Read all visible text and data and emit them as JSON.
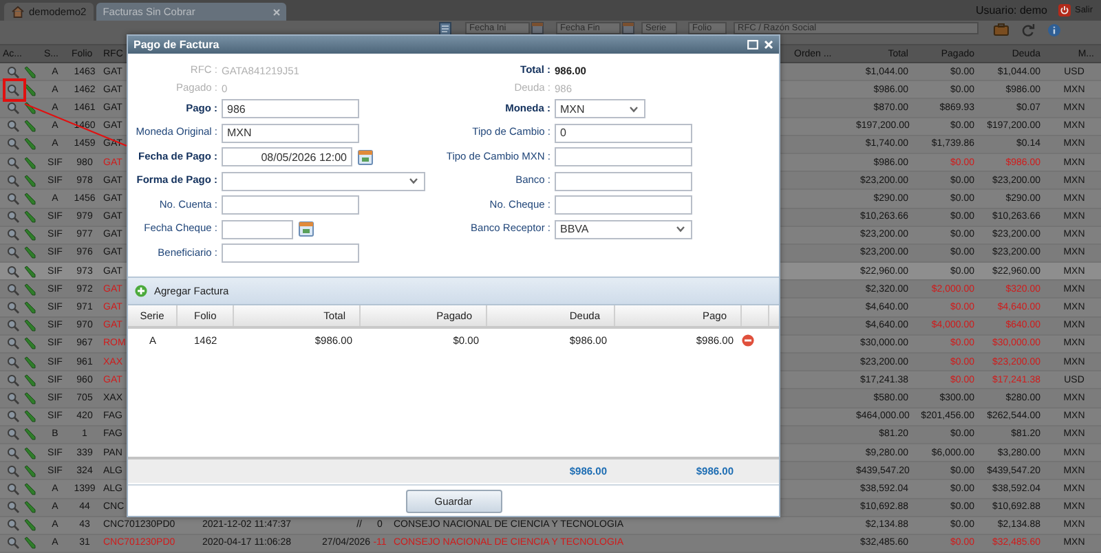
{
  "topbar": {
    "tabs": [
      {
        "label": "demodemo2",
        "kind": "home",
        "selected": false
      },
      {
        "label": "Facturas Sin Cobrar",
        "kind": "closable",
        "selected": true
      }
    ],
    "user": "Usuario: demo",
    "logout": "Salir"
  },
  "filters": [
    {
      "kind": "date",
      "placeholder": "Fecha Ini"
    },
    {
      "kind": "date",
      "placeholder": "Fecha Fin"
    },
    {
      "kind": "select",
      "placeholder": "Serie"
    },
    {
      "kind": "input",
      "placeholder": "Folio"
    },
    {
      "kind": "search",
      "placeholder": "RFC / Razón Social"
    }
  ],
  "table": {
    "columns": [
      "Ac...",
      "S...",
      "Folio",
      "RFC",
      "Orden ...",
      "Total",
      "Pagado",
      "Deuda",
      "M..."
    ],
    "rows": [
      {
        "s": "A",
        "folio": "1463",
        "rfc": "GAT",
        "total": "$1,044.00",
        "pagado": "$0.00",
        "deuda": "$1,044.00",
        "moneda": "USD",
        "overdue": false,
        "selected": false,
        "marked": false
      },
      {
        "s": "A",
        "folio": "1462",
        "rfc": "GAT",
        "total": "$986.00",
        "pagado": "$0.00",
        "deuda": "$986.00",
        "moneda": "MXN",
        "overdue": false,
        "selected": false,
        "marked": true
      },
      {
        "s": "A",
        "folio": "1461",
        "rfc": "GAT",
        "total": "$870.00",
        "pagado": "$869.93",
        "deuda": "$0.07",
        "moneda": "MXN",
        "overdue": false,
        "selected": false,
        "marked": false
      },
      {
        "s": "A",
        "folio": "1460",
        "rfc": "GAT",
        "total": "$197,200.00",
        "pagado": "$0.00",
        "deuda": "$197,200.00",
        "moneda": "MXN",
        "overdue": false,
        "selected": false,
        "marked": false
      },
      {
        "s": "A",
        "folio": "1459",
        "rfc": "GAT",
        "total": "$1,740.00",
        "pagado": "$1,739.86",
        "deuda": "$0.14",
        "moneda": "MXN",
        "overdue": false,
        "selected": false,
        "marked": false
      },
      {
        "s": "SIF",
        "folio": "980",
        "rfc": "GAT",
        "total": "$986.00",
        "pagado": "$0.00",
        "deuda": "$986.00",
        "moneda": "MXN",
        "overdue": true,
        "selected": false,
        "marked": false
      },
      {
        "s": "SIF",
        "folio": "978",
        "rfc": "GAT",
        "total": "$23,200.00",
        "pagado": "$0.00",
        "deuda": "$23,200.00",
        "moneda": "MXN",
        "overdue": false,
        "selected": false,
        "marked": false
      },
      {
        "s": "A",
        "folio": "1456",
        "rfc": "GAT",
        "total": "$290.00",
        "pagado": "$0.00",
        "deuda": "$290.00",
        "moneda": "MXN",
        "overdue": false,
        "selected": false,
        "marked": false
      },
      {
        "s": "SIF",
        "folio": "979",
        "rfc": "GAT",
        "total": "$10,263.66",
        "pagado": "$0.00",
        "deuda": "$10,263.66",
        "moneda": "MXN",
        "overdue": false,
        "selected": false,
        "marked": false
      },
      {
        "s": "SIF",
        "folio": "977",
        "rfc": "GAT",
        "total": "$23,200.00",
        "pagado": "$0.00",
        "deuda": "$23,200.00",
        "moneda": "MXN",
        "overdue": false,
        "selected": false,
        "marked": false
      },
      {
        "s": "SIF",
        "folio": "976",
        "rfc": "GAT",
        "total": "$23,200.00",
        "pagado": "$0.00",
        "deuda": "$23,200.00",
        "moneda": "MXN",
        "overdue": false,
        "selected": false,
        "marked": false
      },
      {
        "s": "SIF",
        "folio": "973",
        "rfc": "GAT",
        "total": "$22,960.00",
        "pagado": "$0.00",
        "deuda": "$22,960.00",
        "moneda": "MXN",
        "overdue": false,
        "selected": true,
        "marked": false
      },
      {
        "s": "SIF",
        "folio": "972",
        "rfc": "GAT",
        "total": "$2,320.00",
        "pagado": "$2,000.00",
        "deuda": "$320.00",
        "moneda": "MXN",
        "overdue": true,
        "selected": false,
        "marked": false
      },
      {
        "s": "SIF",
        "folio": "971",
        "rfc": "GAT",
        "total": "$4,640.00",
        "pagado": "$0.00",
        "deuda": "$4,640.00",
        "moneda": "MXN",
        "overdue": true,
        "selected": false,
        "marked": false
      },
      {
        "s": "SIF",
        "folio": "970",
        "rfc": "GAT",
        "total": "$4,640.00",
        "pagado": "$4,000.00",
        "deuda": "$640.00",
        "moneda": "MXN",
        "overdue": true,
        "selected": false,
        "marked": false
      },
      {
        "s": "SIF",
        "folio": "967",
        "rfc": "ROM",
        "total": "$30,000.00",
        "pagado": "$0.00",
        "deuda": "$30,000.00",
        "moneda": "MXN",
        "overdue": true,
        "selected": false,
        "marked": false
      },
      {
        "s": "SIF",
        "folio": "961",
        "rfc": "XAX",
        "total": "$23,200.00",
        "pagado": "$0.00",
        "deuda": "$23,200.00",
        "moneda": "MXN",
        "overdue": true,
        "selected": false,
        "marked": false
      },
      {
        "s": "SIF",
        "folio": "960",
        "rfc": "GAT",
        "total": "$17,241.38",
        "pagado": "$0.00",
        "deuda": "$17,241.38",
        "moneda": "USD",
        "overdue": true,
        "selected": false,
        "marked": false
      },
      {
        "s": "SIF",
        "folio": "705",
        "rfc": "XAX",
        "total": "$580.00",
        "pagado": "$300.00",
        "deuda": "$280.00",
        "moneda": "MXN",
        "overdue": false,
        "selected": false,
        "marked": false
      },
      {
        "s": "SIF",
        "folio": "420",
        "rfc": "FAG",
        "total": "$464,000.00",
        "pagado": "$201,456.00",
        "deuda": "$262,544.00",
        "moneda": "MXN",
        "overdue": false,
        "selected": false,
        "marked": false
      },
      {
        "s": "B",
        "folio": "1",
        "rfc": "FAG",
        "total": "$81.20",
        "pagado": "$0.00",
        "deuda": "$81.20",
        "moneda": "MXN",
        "overdue": false,
        "selected": false,
        "marked": false
      },
      {
        "s": "SIF",
        "folio": "339",
        "rfc": "PAN",
        "total": "$9,280.00",
        "pagado": "$6,000.00",
        "deuda": "$3,280.00",
        "moneda": "MXN",
        "overdue": false,
        "selected": false,
        "marked": false
      },
      {
        "s": "SIF",
        "folio": "324",
        "rfc": "ALG",
        "total": "$439,547.20",
        "pagado": "$0.00",
        "deuda": "$439,547.20",
        "moneda": "MXN",
        "overdue": false,
        "selected": false,
        "marked": false
      },
      {
        "s": "A",
        "folio": "1399",
        "rfc": "ALG",
        "total": "$38,592.04",
        "pagado": "$0.00",
        "deuda": "$38,592.04",
        "moneda": "MXN",
        "overdue": false,
        "selected": false,
        "marked": false
      },
      {
        "s": "A",
        "folio": "44",
        "rfc": "CNC",
        "total": "$10,692.88",
        "pagado": "$0.00",
        "deuda": "$10,692.88",
        "moneda": "MXN",
        "overdue": false,
        "selected": false,
        "marked": false
      },
      {
        "s": "A",
        "folio": "43",
        "rfc": "CNC701230PD0",
        "fecha": "2021-12-02 11:47:37",
        "vence": "//",
        "dias": "0",
        "nombre": "CONSEJO NACIONAL DE CIENCIA Y TECNOLOGIA",
        "total": "$2,134.88",
        "pagado": "$0.00",
        "deuda": "$2,134.88",
        "moneda": "MXN",
        "overdue": false,
        "selected": false,
        "marked": false
      },
      {
        "s": "A",
        "folio": "31",
        "rfc": "CNC701230PD0",
        "fecha": "2020-04-17 11:06:28",
        "vence": "27/04/2026",
        "dias": "-11",
        "nombre": "CONSEJO NACIONAL DE CIENCIA Y TECNOLOGIA",
        "total": "$32,485.60",
        "pagado": "$0.00",
        "deuda": "$32,485.60",
        "moneda": "MXN",
        "overdue": true,
        "selected": false,
        "marked": false
      }
    ]
  },
  "dialog": {
    "title": "Pago de Factura",
    "form": {
      "left": [
        {
          "kind": "text",
          "label": "RFC :",
          "value": "GATA841219J51",
          "required": false,
          "disabled": true
        },
        {
          "kind": "text",
          "label": "Pagado :",
          "value": "0",
          "required": false,
          "disabled": true
        },
        {
          "kind": "input",
          "label": "Pago :",
          "value": "986",
          "required": true
        },
        {
          "kind": "input",
          "label": "Moneda Original :",
          "value": "MXN",
          "required": false
        },
        {
          "kind": "datetime",
          "label": "Fecha de Pago :",
          "value": "08/05/2026 12:00",
          "required": true
        },
        {
          "kind": "select",
          "label": "Forma de Pago :",
          "required": true
        },
        {
          "kind": "input",
          "label": "No. Cuenta :",
          "required": false
        },
        {
          "kind": "date",
          "label": "Fecha Cheque :",
          "required": false
        },
        {
          "kind": "input",
          "label": "Beneficiario :",
          "required": false
        }
      ],
      "right": [
        {
          "kind": "text",
          "label": "Total :",
          "value": "986.00",
          "required": true,
          "disabled": false
        },
        {
          "kind": "text",
          "label": "Deuda :",
          "value": "986",
          "required": false,
          "disabled": true
        },
        {
          "kind": "select",
          "label": "Moneda :",
          "value": "MXN",
          "required": true
        },
        {
          "kind": "input",
          "label": "Tipo de Cambio :",
          "value": "0",
          "required": false
        },
        {
          "kind": "input",
          "label": "Tipo de Cambio MXN :",
          "required": false
        },
        {
          "kind": "input",
          "label": "Banco :",
          "required": false
        },
        {
          "kind": "input",
          "label": "No. Cheque :",
          "required": false
        },
        {
          "kind": "select",
          "label": "Banco Receptor :",
          "value": "BBVA",
          "required": false
        }
      ]
    },
    "grid": {
      "add_button": "Agregar Factura",
      "columns": [
        "Serie",
        "Folio",
        "Total",
        "Pagado",
        "Deuda",
        "Pago"
      ],
      "rows": [
        {
          "serie": "A",
          "folio": "1462",
          "total": "$986.00",
          "pagado": "$0.00",
          "deuda": "$986.00",
          "pago": "$986.00"
        }
      ],
      "summary": {
        "deuda": "$986.00",
        "pago": "$986.00"
      }
    },
    "save_button": "Guardar"
  }
}
